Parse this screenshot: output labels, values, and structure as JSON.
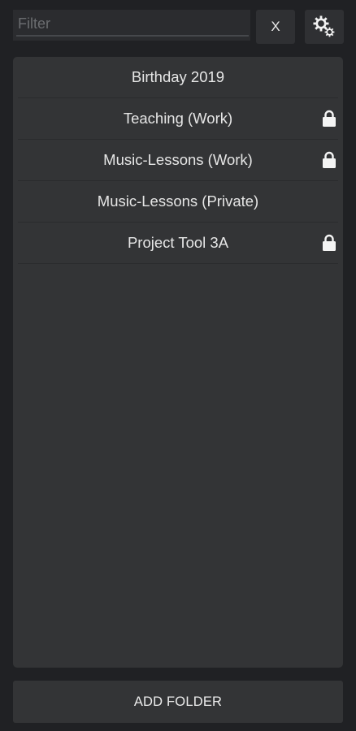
{
  "filter": {
    "placeholder": "Filter",
    "value": ""
  },
  "clear_button": {
    "label": "X"
  },
  "settings_button": {
    "icon": "gears-icon"
  },
  "folders": [
    {
      "label": "Birthday 2019",
      "locked": false
    },
    {
      "label": "Teaching (Work)",
      "locked": true
    },
    {
      "label": "Music-Lessons (Work)",
      "locked": true
    },
    {
      "label": "Music-Lessons (Private)",
      "locked": false
    },
    {
      "label": "Project Tool 3A",
      "locked": true
    }
  ],
  "add_folder": {
    "label": "ADD FOLDER"
  },
  "colors": {
    "background": "#202124",
    "panel": "#333436",
    "text": "#e6e6e6"
  }
}
